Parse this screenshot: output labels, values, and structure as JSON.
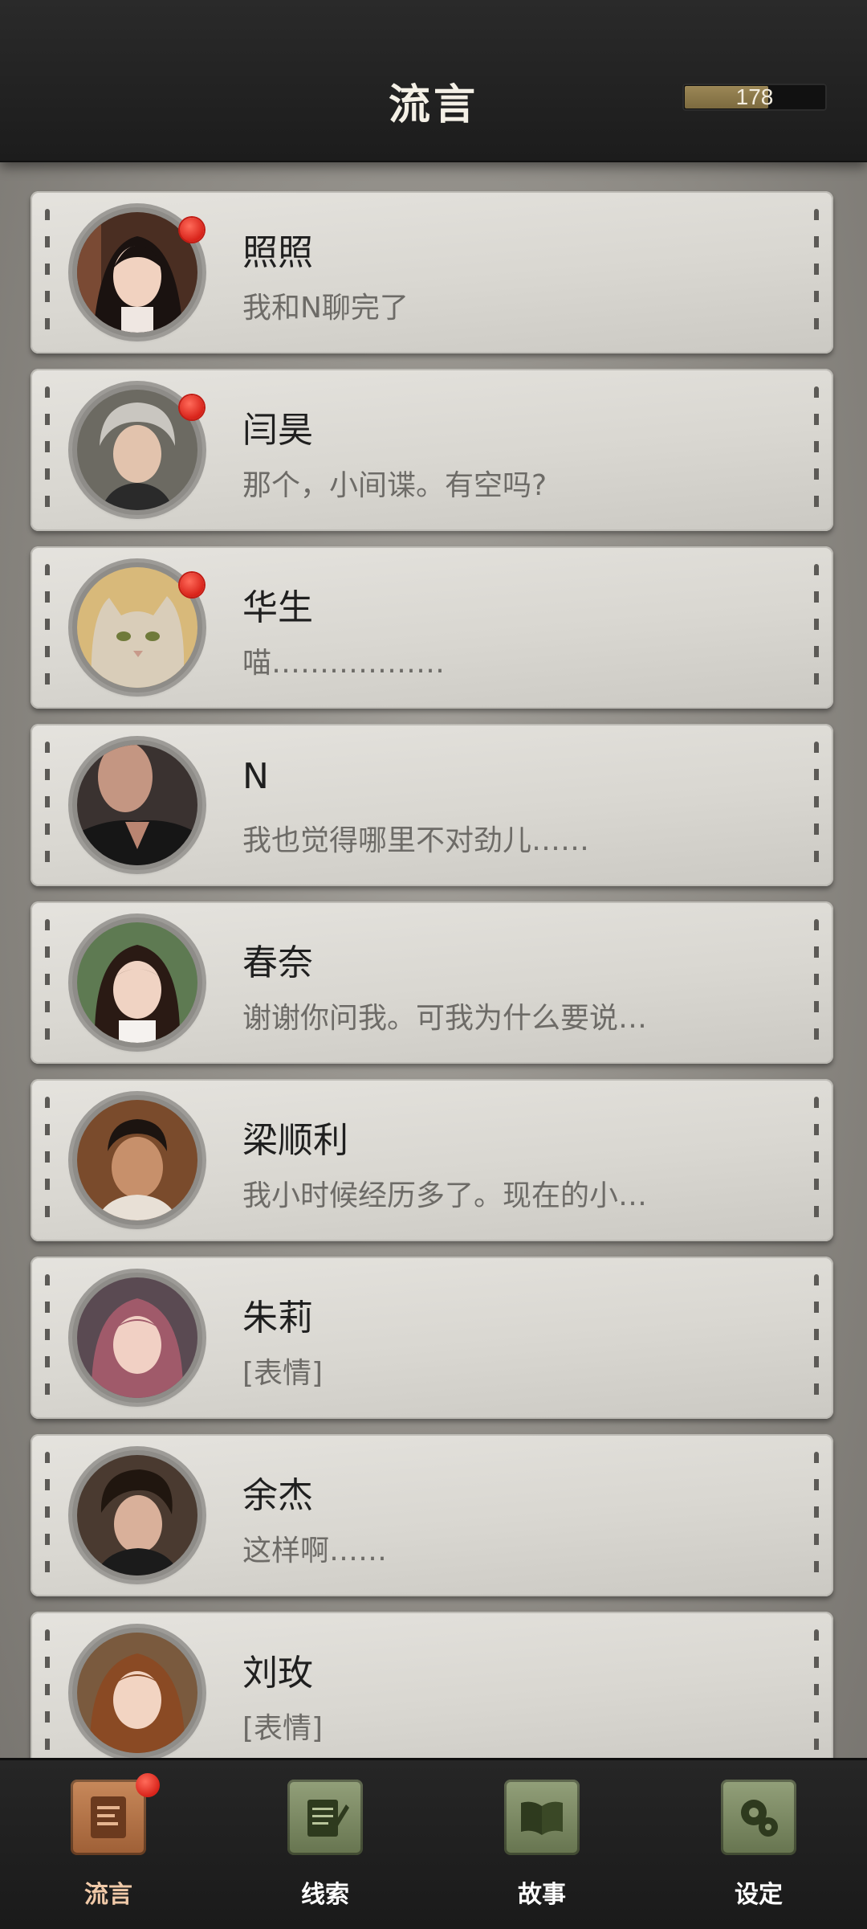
{
  "header": {
    "title": "流言",
    "currency": "178",
    "currency_fill_fraction": 0.6
  },
  "chats": [
    {
      "name": "照照",
      "preview": "我和N聊完了",
      "unread": true
    },
    {
      "name": "闫昊",
      "preview": "那个，小间谍。有空吗?",
      "unread": true
    },
    {
      "name": "华生",
      "preview": "喵………………",
      "unread": true
    },
    {
      "name": "N",
      "preview": "我也觉得哪里不对劲儿……",
      "unread": false
    },
    {
      "name": "春奈",
      "preview": "谢谢你问我。可我为什么要说…",
      "unread": false
    },
    {
      "name": "梁顺利",
      "preview": "我小时候经历多了。现在的小…",
      "unread": false
    },
    {
      "name": "朱莉",
      "preview": "[表情]",
      "unread": false
    },
    {
      "name": "余杰",
      "preview": "这样啊……",
      "unread": false
    },
    {
      "name": "刘玫",
      "preview": "[表情]",
      "unread": false
    }
  ],
  "nav": [
    {
      "label": "流言",
      "icon": "note-icon",
      "active": true,
      "badge": true
    },
    {
      "label": "线索",
      "icon": "notepad-pen-icon",
      "active": false,
      "badge": false
    },
    {
      "label": "故事",
      "icon": "book-icon",
      "active": false,
      "badge": false
    },
    {
      "label": "设定",
      "icon": "gears-icon",
      "active": false,
      "badge": false
    }
  ],
  "colors": {
    "header_bg": "#1f1f1f",
    "card_bg": "#dcdad4",
    "unread_dot": "#d8231a",
    "nav_active": "#b87a4d",
    "nav_inactive": "#7c8a62"
  }
}
